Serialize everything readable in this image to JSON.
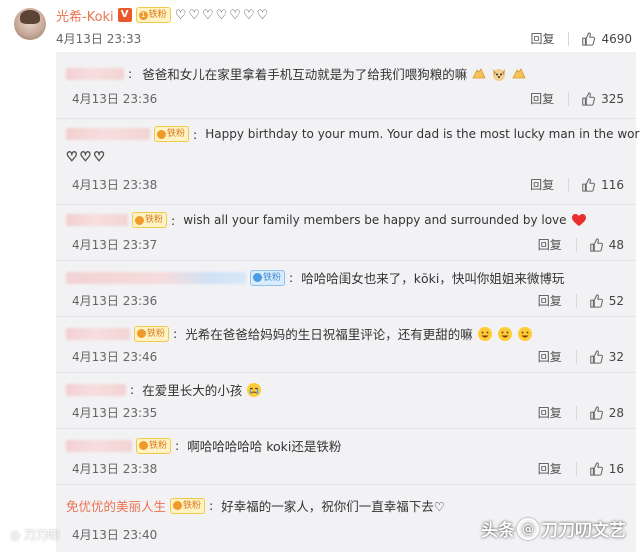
{
  "main_comment": {
    "username": "光希-Koki",
    "verified_badge": "V",
    "fan_badge": "铁粉",
    "fan_level": "1",
    "text": "♡♡♡♡♡♡♡",
    "time": "4月13日 23:33",
    "reply_label": "回复",
    "likes": "4690"
  },
  "replies": [
    {
      "text": "爸爸和女儿在家里拿着手机互动就是为了给我们喂狗粮的嘛",
      "time": "4月13日 23:36",
      "reply_label": "回复",
      "likes": "325"
    },
    {
      "fan_badge": "铁粉",
      "text": "Happy birthday to your mum.  Your dad is the most lucky man in the world",
      "text2": "♡♡♡",
      "time": "4月13日 23:38",
      "reply_label": "回复",
      "likes": "116"
    },
    {
      "fan_badge": "铁粉",
      "text": "wish all your family members be happy and surrounded by love",
      "time": "4月13日 23:37",
      "reply_label": "回复",
      "likes": "48"
    },
    {
      "fan_badge": "铁粉",
      "text": "哈哈哈闺女也来了，kōki，快叫你姐姐来微博玩",
      "time": "4月13日 23:36",
      "reply_label": "回复",
      "likes": "52"
    },
    {
      "fan_badge": "铁粉",
      "text": "光希在爸爸给妈妈的生日祝福里评论，还有更甜的嘛",
      "time": "4月13日 23:46",
      "reply_label": "回复",
      "likes": "32"
    },
    {
      "text": "在爱里长大的小孩",
      "time": "4月13日 23:35",
      "reply_label": "回复",
      "likes": "28"
    },
    {
      "fan_badge": "铁粉",
      "text": "啊哈哈哈哈哈 koki还是铁粉",
      "time": "4月13日 23:38",
      "reply_label": "回复",
      "likes": "16"
    },
    {
      "username": "免优优的美丽人生",
      "fan_badge": "铁粉",
      "text": "好幸福的一家人，祝你们一直幸福下去♡",
      "time": "4月13日 23:40"
    }
  ],
  "watermark": {
    "left_text": "刀刀叨",
    "right_prefix": "头条",
    "right_name": "刀刀叨文艺"
  },
  "colors": {
    "username_orange": "#eb7350",
    "panel_bg": "#f2f2f5",
    "badge_bg": "#fff3c4"
  }
}
